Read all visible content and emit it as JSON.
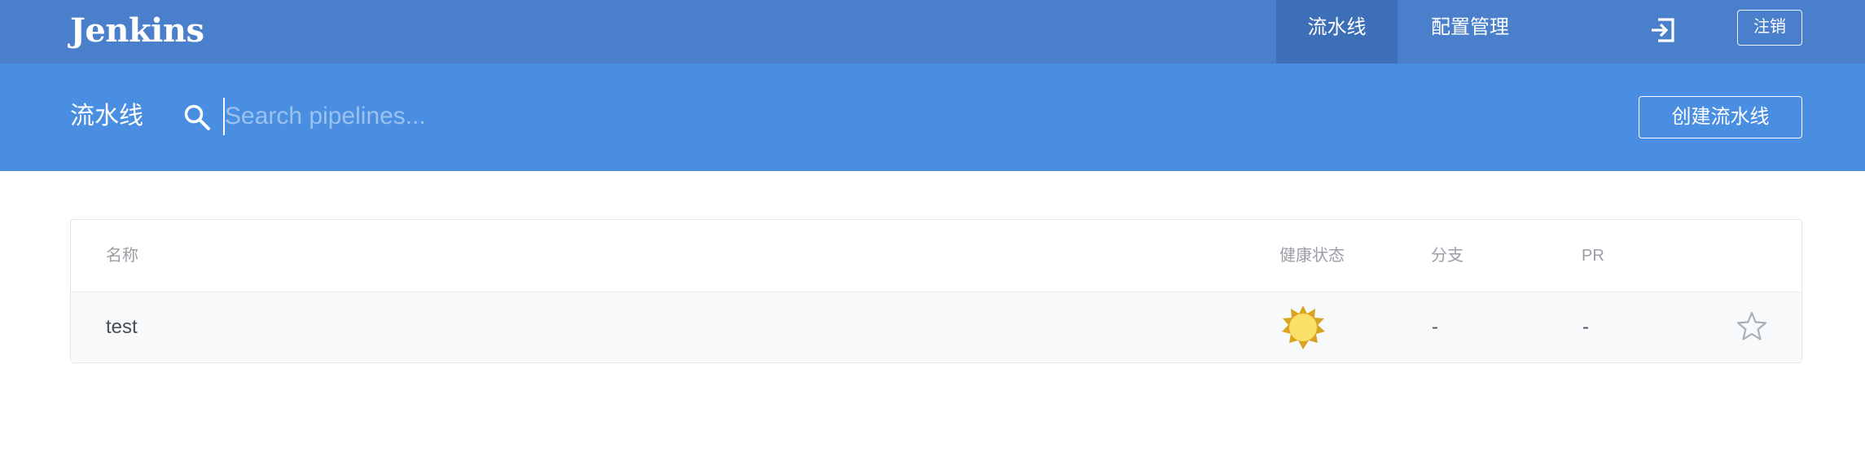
{
  "app": {
    "brand": "Jenkins"
  },
  "nav": {
    "tabs": [
      {
        "label": "流水线",
        "active": true
      },
      {
        "label": "配置管理",
        "active": false
      }
    ],
    "login_icon": "sign-in-icon",
    "logout_label": "注销"
  },
  "subheader": {
    "title": "流水线",
    "search": {
      "icon": "search-icon",
      "placeholder": "Search pipelines...",
      "value": ""
    },
    "create_button_label": "创建流水线"
  },
  "table": {
    "columns": {
      "name": "名称",
      "health": "健康状态",
      "branches": "分支",
      "pr": "PR"
    },
    "rows": [
      {
        "name": "test",
        "health_icon": "weather-sunny-icon",
        "branches": "-",
        "pr": "-",
        "favorite_icon": "star-outline-icon"
      }
    ]
  },
  "colors": {
    "topbar": "#4a7fcb",
    "topbar_active_tab": "#3d6fb6",
    "subheader": "#4a8ee2",
    "row_bg": "#f8f9fb",
    "sun_fill": "#fbe06a",
    "sun_rays": "#d9a521"
  }
}
